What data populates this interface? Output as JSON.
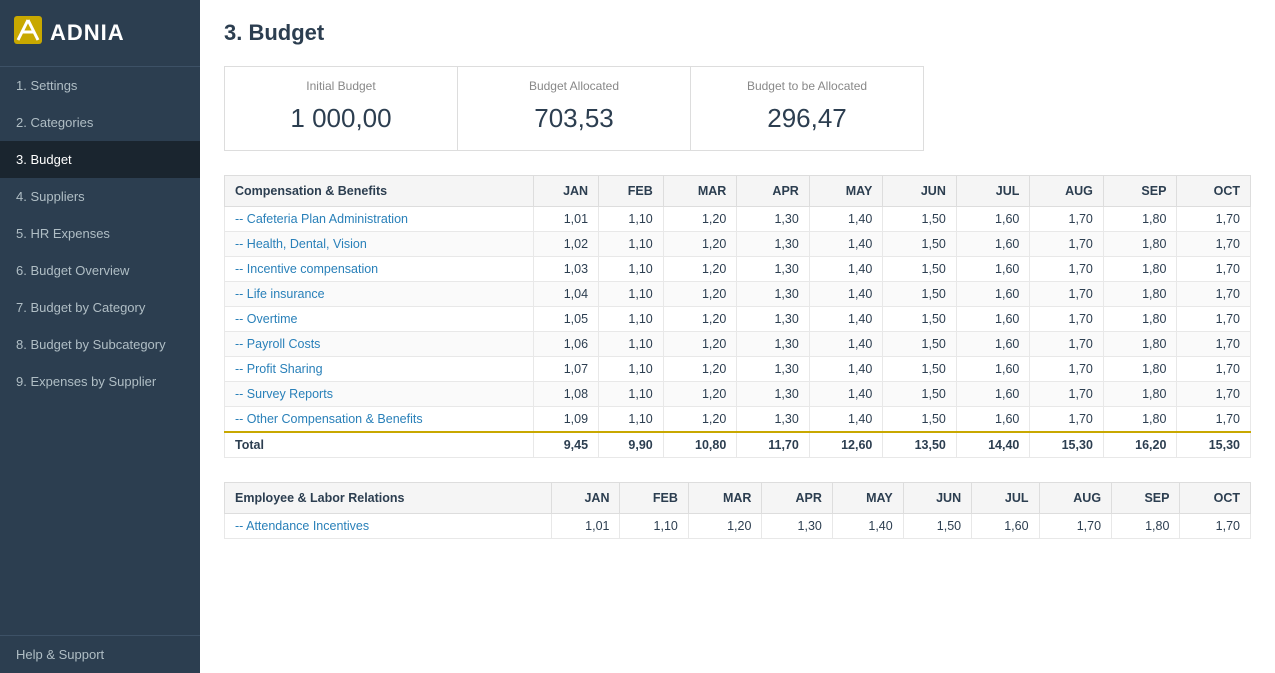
{
  "logo": {
    "icon": "⟋",
    "text": "ADNIA"
  },
  "sidebar": {
    "items": [
      {
        "id": "settings",
        "label": "1. Settings",
        "active": false
      },
      {
        "id": "categories",
        "label": "2. Categories",
        "active": false
      },
      {
        "id": "budget",
        "label": "3. Budget",
        "active": true
      },
      {
        "id": "suppliers",
        "label": "4. Suppliers",
        "active": false
      },
      {
        "id": "hr-expenses",
        "label": "5. HR Expenses",
        "active": false
      },
      {
        "id": "budget-overview",
        "label": "6. Budget Overview",
        "active": false
      },
      {
        "id": "budget-by-category",
        "label": "7. Budget by Category",
        "active": false
      },
      {
        "id": "budget-by-subcategory",
        "label": "8. Budget by Subcategory",
        "active": false
      },
      {
        "id": "expenses-by-supplier",
        "label": "9. Expenses by Supplier",
        "active": false
      }
    ],
    "help": "Help & Support"
  },
  "page": {
    "title": "3. Budget"
  },
  "budget_summary": {
    "initial": {
      "label": "Initial Budget",
      "value": "1 000,00"
    },
    "allocated": {
      "label": "Budget Allocated",
      "value": "703,53"
    },
    "to_be_allocated": {
      "label": "Budget to be Allocated",
      "value": "296,47"
    }
  },
  "table1": {
    "category": "Compensation & Benefits",
    "columns": [
      "JAN",
      "FEB",
      "MAR",
      "APR",
      "MAY",
      "JUN",
      "JUL",
      "AUG",
      "SEP",
      "OCT"
    ],
    "rows": [
      {
        "label": "-- Cafeteria Plan Administration",
        "values": [
          "1,01",
          "1,10",
          "1,20",
          "1,30",
          "1,40",
          "1,50",
          "1,60",
          "1,70",
          "1,80",
          "1,70"
        ]
      },
      {
        "label": "-- Health, Dental, Vision",
        "values": [
          "1,02",
          "1,10",
          "1,20",
          "1,30",
          "1,40",
          "1,50",
          "1,60",
          "1,70",
          "1,80",
          "1,70"
        ]
      },
      {
        "label": "-- Incentive compensation",
        "values": [
          "1,03",
          "1,10",
          "1,20",
          "1,30",
          "1,40",
          "1,50",
          "1,60",
          "1,70",
          "1,80",
          "1,70"
        ]
      },
      {
        "label": "-- Life insurance",
        "values": [
          "1,04",
          "1,10",
          "1,20",
          "1,30",
          "1,40",
          "1,50",
          "1,60",
          "1,70",
          "1,80",
          "1,70"
        ]
      },
      {
        "label": "-- Overtime",
        "values": [
          "1,05",
          "1,10",
          "1,20",
          "1,30",
          "1,40",
          "1,50",
          "1,60",
          "1,70",
          "1,80",
          "1,70"
        ]
      },
      {
        "label": "-- Payroll Costs",
        "values": [
          "1,06",
          "1,10",
          "1,20",
          "1,30",
          "1,40",
          "1,50",
          "1,60",
          "1,70",
          "1,80",
          "1,70"
        ]
      },
      {
        "label": "-- Profit Sharing",
        "values": [
          "1,07",
          "1,10",
          "1,20",
          "1,30",
          "1,40",
          "1,50",
          "1,60",
          "1,70",
          "1,80",
          "1,70"
        ]
      },
      {
        "label": "-- Survey Reports",
        "values": [
          "1,08",
          "1,10",
          "1,20",
          "1,30",
          "1,40",
          "1,50",
          "1,60",
          "1,70",
          "1,80",
          "1,70"
        ]
      },
      {
        "label": "-- Other Compensation & Benefits",
        "values": [
          "1,09",
          "1,10",
          "1,20",
          "1,30",
          "1,40",
          "1,50",
          "1,60",
          "1,70",
          "1,80",
          "1,70"
        ]
      }
    ],
    "total": {
      "label": "Total",
      "values": [
        "9,45",
        "9,90",
        "10,80",
        "11,70",
        "12,60",
        "13,50",
        "14,40",
        "15,30",
        "16,20",
        "15,30"
      ]
    }
  },
  "table2": {
    "category": "Employee & Labor Relations",
    "columns": [
      "JAN",
      "FEB",
      "MAR",
      "APR",
      "MAY",
      "JUN",
      "JUL",
      "AUG",
      "SEP",
      "OCT"
    ],
    "rows": [
      {
        "label": "-- Attendance Incentives",
        "values": [
          "1,01",
          "1,10",
          "1,20",
          "1,30",
          "1,40",
          "1,50",
          "1,60",
          "1,70",
          "1,80",
          "1,70"
        ]
      }
    ]
  }
}
